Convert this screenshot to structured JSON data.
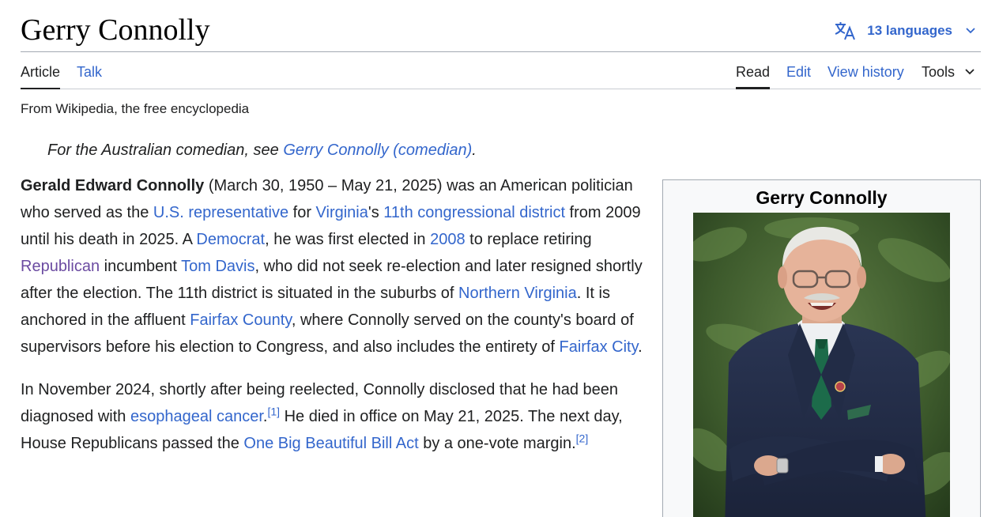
{
  "header": {
    "title": "Gerry Connolly",
    "languages_label": "13 languages"
  },
  "tabs": {
    "article": "Article",
    "talk": "Talk",
    "read": "Read",
    "edit": "Edit",
    "view_history": "View history",
    "tools": "Tools"
  },
  "tagline": "From Wikipedia, the free encyclopedia",
  "hatnote": {
    "prefix": "For the Australian comedian, see ",
    "link": "Gerry Connolly (comedian)",
    "suffix": "."
  },
  "paragraph1": {
    "bold_name": "Gerald Edward Connolly",
    "t1": " (March 30, 1950 – May 21, 2025) was an American politician who served as the ",
    "l1": "U.S. representative",
    "t2": " for ",
    "l2": "Virginia",
    "t3": "'s ",
    "l3": "11th congressional district",
    "t4": " from 2009 until his death in 2025. A ",
    "l4": "Democrat",
    "t5": ", he was first elected in ",
    "l5": "2008",
    "t6": " to replace retiring ",
    "l6": "Republican",
    "t7": " incumbent ",
    "l7": "Tom Davis",
    "t8": ", who did not seek re-election and later resigned shortly after the election. The 11th district is situated in the suburbs of ",
    "l8": "Northern Virginia",
    "t9": ". It is anchored in the affluent ",
    "l9": "Fairfax County",
    "t10": ", where Connolly served on the county's board of supervisors before his election to Congress, and also includes the entirety of ",
    "l10": "Fairfax City",
    "t11": "."
  },
  "paragraph2": {
    "t1": "In November 2024, shortly after being reelected, Connolly disclosed that he had been diagnosed with ",
    "l1": "esophageal cancer",
    "t2": ".",
    "ref1": "[1]",
    "t3": " He died in office on May 21, 2025. The next day, House Republicans passed the ",
    "l2": "One Big Beautiful Bill Act",
    "t4": " by a one-vote margin.",
    "ref2": "[2]"
  },
  "infobox": {
    "title": "Gerry Connolly"
  },
  "colors": {
    "link": "#3366cc",
    "visited_link": "#6b4ba1",
    "text": "#202122"
  },
  "icons": {
    "language": "translate-icon",
    "dropdown": "chevron-down-icon"
  }
}
